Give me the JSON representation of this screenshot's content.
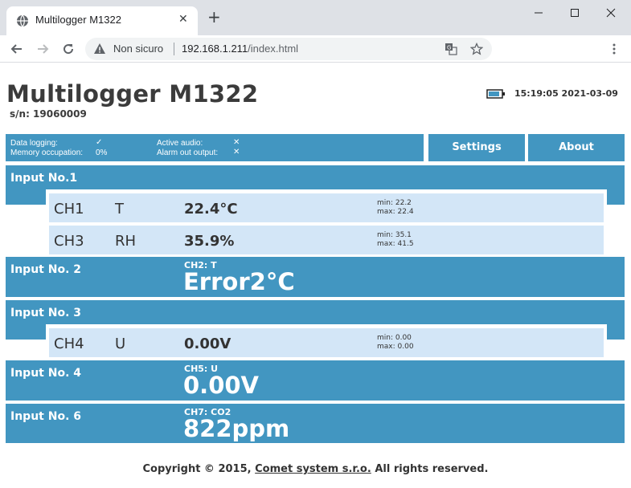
{
  "browser": {
    "tab_title": "Multilogger M1322",
    "close_glyph": "✕",
    "new_tab_glyph": "+",
    "security_label": "Non sicuro",
    "url_host": "192.168.1.211",
    "url_path": "/index.html",
    "icons": [
      "globe-icon",
      "back-icon",
      "forward-icon",
      "reload-icon",
      "warning-icon",
      "translate-icon",
      "star-icon",
      "menu-icon",
      "minimize-icon",
      "maximize-icon",
      "close-icon"
    ]
  },
  "header": {
    "title": "Multilogger M1322",
    "serial": "s/n: 19060009",
    "time": "15:19:05 2021-03-09"
  },
  "status": {
    "data_logging_label": "Data logging:",
    "data_logging_value": "✓",
    "memory_label": "Memory occupation:",
    "memory_value": "0%",
    "active_audio_label": "Active audio:",
    "active_audio_value": "✕",
    "alarm_label": "Alarm out output:",
    "alarm_value": "✕"
  },
  "menu": {
    "settings": "Settings",
    "about": "About"
  },
  "inputs": {
    "in1": {
      "label": "Input No.1",
      "channels": [
        {
          "name": "CH1",
          "qty": "T",
          "value": "22.4°C",
          "min": "min: 22.2",
          "max": "max: 22.4"
        },
        {
          "name": "CH3",
          "qty": "RH",
          "value": "35.9%",
          "min": "min: 35.1",
          "max": "max: 41.5"
        }
      ]
    },
    "in2": {
      "label": "Input No. 2",
      "sub": "CH2: T",
      "value": "Error2°C"
    },
    "in3": {
      "label": "Input No. 3",
      "channels": [
        {
          "name": "CH4",
          "qty": "U",
          "value": "0.00V",
          "min": "min: 0.00",
          "max": "max: 0.00"
        }
      ]
    },
    "in4": {
      "label": "Input No. 4",
      "sub": "CH5: U",
      "value": "0.00V"
    },
    "in6": {
      "label": "Input No. 6",
      "sub": "CH7: CO2",
      "value": "822ppm"
    }
  },
  "footer": {
    "prefix": "Copyright © 2015,",
    "link": "Comet system s.r.o.",
    "suffix": "All rights reserved."
  },
  "colors": {
    "accent": "#4296c1",
    "channel_row": "#d3e6f7",
    "tabbar": "#dee1e6"
  }
}
